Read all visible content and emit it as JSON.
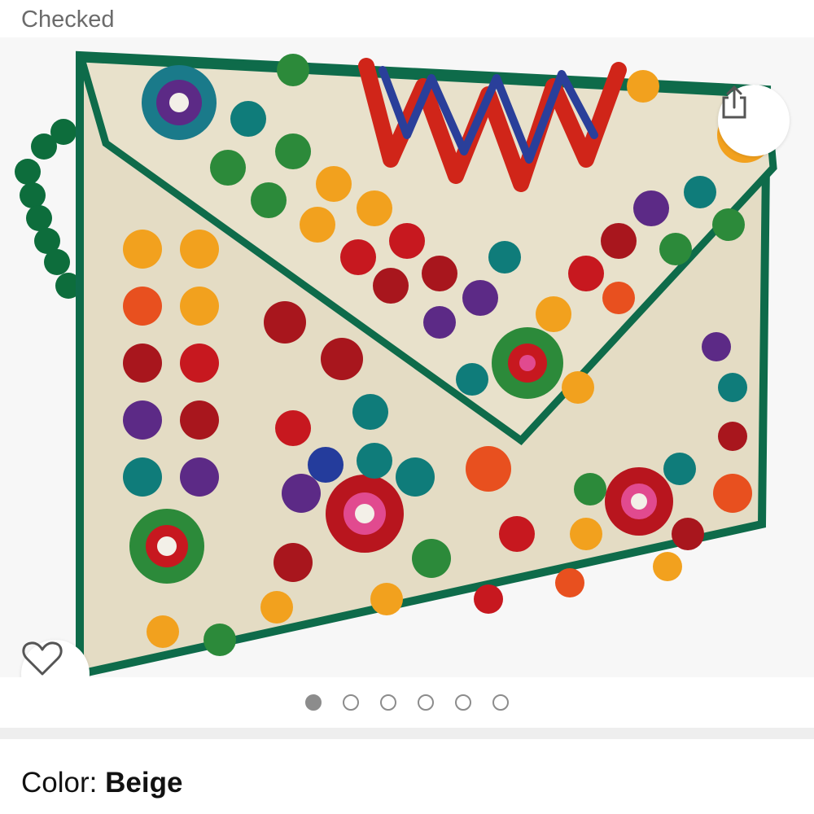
{
  "header": {
    "label": "Checked"
  },
  "product_image": {
    "alt": "Embroidered clutch bag",
    "active_index": 0,
    "total_images": 6,
    "colors": {
      "fabric": "#e4dcc4",
      "trim": "#0e6b4a",
      "handle": "#0d6d3c"
    }
  },
  "actions": {
    "share_icon": "share-icon",
    "wishlist_icon": "heart-icon"
  },
  "variant": {
    "label": "Color:",
    "value": "Beige"
  }
}
